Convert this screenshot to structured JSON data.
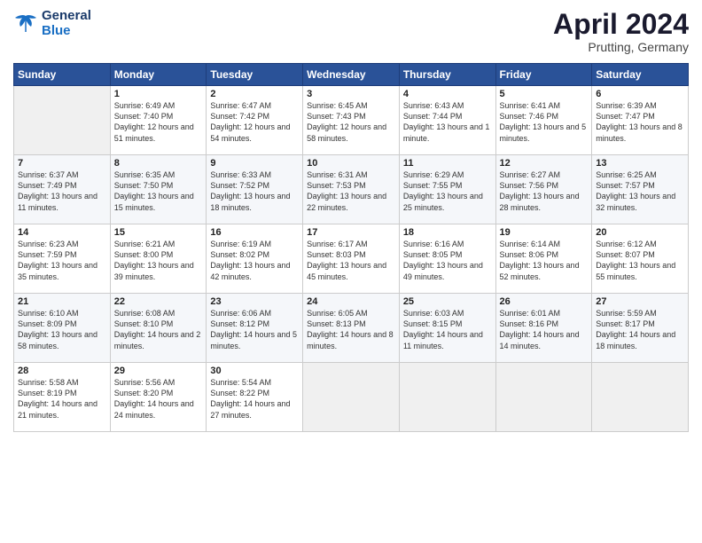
{
  "header": {
    "logo_line1": "General",
    "logo_line2": "Blue",
    "month": "April 2024",
    "location": "Prutting, Germany"
  },
  "days_of_week": [
    "Sunday",
    "Monday",
    "Tuesday",
    "Wednesday",
    "Thursday",
    "Friday",
    "Saturday"
  ],
  "weeks": [
    [
      {
        "day": "",
        "empty": true
      },
      {
        "day": "1",
        "sunrise": "Sunrise: 6:49 AM",
        "sunset": "Sunset: 7:40 PM",
        "daylight": "Daylight: 12 hours and 51 minutes."
      },
      {
        "day": "2",
        "sunrise": "Sunrise: 6:47 AM",
        "sunset": "Sunset: 7:42 PM",
        "daylight": "Daylight: 12 hours and 54 minutes."
      },
      {
        "day": "3",
        "sunrise": "Sunrise: 6:45 AM",
        "sunset": "Sunset: 7:43 PM",
        "daylight": "Daylight: 12 hours and 58 minutes."
      },
      {
        "day": "4",
        "sunrise": "Sunrise: 6:43 AM",
        "sunset": "Sunset: 7:44 PM",
        "daylight": "Daylight: 13 hours and 1 minute."
      },
      {
        "day": "5",
        "sunrise": "Sunrise: 6:41 AM",
        "sunset": "Sunset: 7:46 PM",
        "daylight": "Daylight: 13 hours and 5 minutes."
      },
      {
        "day": "6",
        "sunrise": "Sunrise: 6:39 AM",
        "sunset": "Sunset: 7:47 PM",
        "daylight": "Daylight: 13 hours and 8 minutes."
      }
    ],
    [
      {
        "day": "7",
        "sunrise": "Sunrise: 6:37 AM",
        "sunset": "Sunset: 7:49 PM",
        "daylight": "Daylight: 13 hours and 11 minutes."
      },
      {
        "day": "8",
        "sunrise": "Sunrise: 6:35 AM",
        "sunset": "Sunset: 7:50 PM",
        "daylight": "Daylight: 13 hours and 15 minutes."
      },
      {
        "day": "9",
        "sunrise": "Sunrise: 6:33 AM",
        "sunset": "Sunset: 7:52 PM",
        "daylight": "Daylight: 13 hours and 18 minutes."
      },
      {
        "day": "10",
        "sunrise": "Sunrise: 6:31 AM",
        "sunset": "Sunset: 7:53 PM",
        "daylight": "Daylight: 13 hours and 22 minutes."
      },
      {
        "day": "11",
        "sunrise": "Sunrise: 6:29 AM",
        "sunset": "Sunset: 7:55 PM",
        "daylight": "Daylight: 13 hours and 25 minutes."
      },
      {
        "day": "12",
        "sunrise": "Sunrise: 6:27 AM",
        "sunset": "Sunset: 7:56 PM",
        "daylight": "Daylight: 13 hours and 28 minutes."
      },
      {
        "day": "13",
        "sunrise": "Sunrise: 6:25 AM",
        "sunset": "Sunset: 7:57 PM",
        "daylight": "Daylight: 13 hours and 32 minutes."
      }
    ],
    [
      {
        "day": "14",
        "sunrise": "Sunrise: 6:23 AM",
        "sunset": "Sunset: 7:59 PM",
        "daylight": "Daylight: 13 hours and 35 minutes."
      },
      {
        "day": "15",
        "sunrise": "Sunrise: 6:21 AM",
        "sunset": "Sunset: 8:00 PM",
        "daylight": "Daylight: 13 hours and 39 minutes."
      },
      {
        "day": "16",
        "sunrise": "Sunrise: 6:19 AM",
        "sunset": "Sunset: 8:02 PM",
        "daylight": "Daylight: 13 hours and 42 minutes."
      },
      {
        "day": "17",
        "sunrise": "Sunrise: 6:17 AM",
        "sunset": "Sunset: 8:03 PM",
        "daylight": "Daylight: 13 hours and 45 minutes."
      },
      {
        "day": "18",
        "sunrise": "Sunrise: 6:16 AM",
        "sunset": "Sunset: 8:05 PM",
        "daylight": "Daylight: 13 hours and 49 minutes."
      },
      {
        "day": "19",
        "sunrise": "Sunrise: 6:14 AM",
        "sunset": "Sunset: 8:06 PM",
        "daylight": "Daylight: 13 hours and 52 minutes."
      },
      {
        "day": "20",
        "sunrise": "Sunrise: 6:12 AM",
        "sunset": "Sunset: 8:07 PM",
        "daylight": "Daylight: 13 hours and 55 minutes."
      }
    ],
    [
      {
        "day": "21",
        "sunrise": "Sunrise: 6:10 AM",
        "sunset": "Sunset: 8:09 PM",
        "daylight": "Daylight: 13 hours and 58 minutes."
      },
      {
        "day": "22",
        "sunrise": "Sunrise: 6:08 AM",
        "sunset": "Sunset: 8:10 PM",
        "daylight": "Daylight: 14 hours and 2 minutes."
      },
      {
        "day": "23",
        "sunrise": "Sunrise: 6:06 AM",
        "sunset": "Sunset: 8:12 PM",
        "daylight": "Daylight: 14 hours and 5 minutes."
      },
      {
        "day": "24",
        "sunrise": "Sunrise: 6:05 AM",
        "sunset": "Sunset: 8:13 PM",
        "daylight": "Daylight: 14 hours and 8 minutes."
      },
      {
        "day": "25",
        "sunrise": "Sunrise: 6:03 AM",
        "sunset": "Sunset: 8:15 PM",
        "daylight": "Daylight: 14 hours and 11 minutes."
      },
      {
        "day": "26",
        "sunrise": "Sunrise: 6:01 AM",
        "sunset": "Sunset: 8:16 PM",
        "daylight": "Daylight: 14 hours and 14 minutes."
      },
      {
        "day": "27",
        "sunrise": "Sunrise: 5:59 AM",
        "sunset": "Sunset: 8:17 PM",
        "daylight": "Daylight: 14 hours and 18 minutes."
      }
    ],
    [
      {
        "day": "28",
        "sunrise": "Sunrise: 5:58 AM",
        "sunset": "Sunset: 8:19 PM",
        "daylight": "Daylight: 14 hours and 21 minutes."
      },
      {
        "day": "29",
        "sunrise": "Sunrise: 5:56 AM",
        "sunset": "Sunset: 8:20 PM",
        "daylight": "Daylight: 14 hours and 24 minutes."
      },
      {
        "day": "30",
        "sunrise": "Sunrise: 5:54 AM",
        "sunset": "Sunset: 8:22 PM",
        "daylight": "Daylight: 14 hours and 27 minutes."
      },
      {
        "day": "",
        "empty": true
      },
      {
        "day": "",
        "empty": true
      },
      {
        "day": "",
        "empty": true
      },
      {
        "day": "",
        "empty": true
      }
    ]
  ]
}
